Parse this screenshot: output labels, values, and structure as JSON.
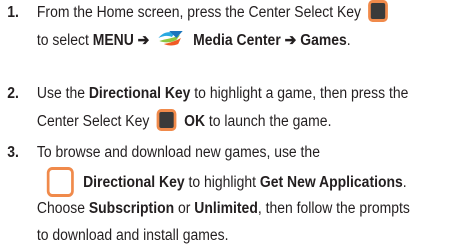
{
  "steps": [
    {
      "number": "1.",
      "line1_text": "From the Home screen, press the Center Select Key",
      "line2_prefix": "to select ",
      "menu": "MENU",
      "arrow1": "➔",
      "media_center": "Media Center",
      "arrow2": "➔",
      "games": "Games",
      "period": "."
    },
    {
      "number": "2.",
      "line1_prefix": "Use the ",
      "directional_key": "Directional Key",
      "line1_suffix": " to highlight a game, then press the",
      "line2_prefix": "Center Select Key",
      "ok": "OK",
      "line2_suffix": " to launch the game."
    },
    {
      "number": "3.",
      "line1_text": "To browse and download new games, use the",
      "directional_key": "Directional Key",
      "line2_middle": " to highlight ",
      "get_new_apps": "Get New Applications",
      "period": ".",
      "choose": "Choose ",
      "subscription": "Subscription",
      "or": " or ",
      "unlimited": "Unlimited",
      "line3_suffix": ", then follow the prompts",
      "line4_text": "to download and install games."
    }
  ],
  "icons": {
    "center_select_key": "center-select-key-icon",
    "directional_key": "directional-key-icon",
    "media_center": "media-center-icon"
  },
  "colors": {
    "text": "#231f20",
    "key_ring": "#f08a4b",
    "key_fill": "#3a3a3a"
  }
}
